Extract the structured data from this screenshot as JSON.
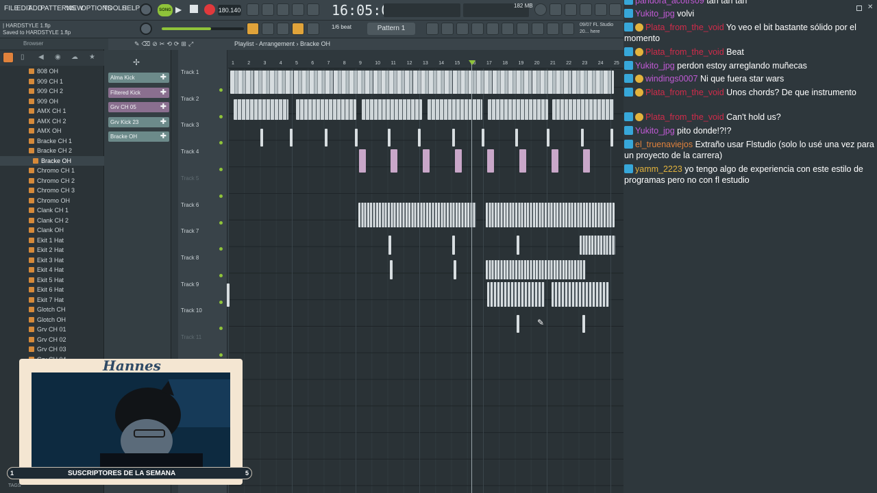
{
  "menu": [
    "FILE",
    "EDIT",
    "ADD",
    "PATTERNS",
    "VIEW",
    "OPTIONS",
    "TOOLS",
    "HELP"
  ],
  "transport": {
    "mode": "SONG",
    "tempo": "180.140",
    "time": "16:05:00",
    "cpu": "182 MB"
  },
  "hints": {
    "file": "| HARDSTYLE 1.flp",
    "saved": "Saved to HARDSTYLE 1.flp"
  },
  "toolbar": {
    "snap": "1/6 beat",
    "pattern": "Pattern 1",
    "news": "09/07 FL Studio 20... here"
  },
  "browser": {
    "title": "Browser",
    "items": [
      "808 OH",
      "909 CH 1",
      "909 CH 2",
      "909 OH",
      "AMX CH 1",
      "AMX CH 2",
      "AMX OH",
      "Bracke CH 1",
      "Bracke CH 2",
      "Bracke OH",
      "Chromo CH 1",
      "Chromo CH 2",
      "Chromo CH 3",
      "Chromo OH",
      "Clank CH 1",
      "Clank CH 2",
      "Clank OH",
      "Ekit 1 Hat",
      "Ekit 2 Hat",
      "Ekit 3 Hat",
      "Ekit 4 Hat",
      "Ekit 5 Hat",
      "Ekit 6 Hat",
      "Ekit 7 Hat",
      "Glotch CH",
      "Glotch OH",
      "Grv CH 01",
      "Grv CH 02",
      "Grv CH 03",
      "Grv CH 04"
    ],
    "selected": "Bracke OH",
    "bottom": "TAGS"
  },
  "channels": [
    {
      "name": "Alma Kick",
      "color": "#6c8a8a"
    },
    {
      "name": "Filtered Kick",
      "color": "#8a6f8f"
    },
    {
      "name": "Grv CH 05",
      "color": "#8a6f8f"
    },
    {
      "name": "Grv Kick 23",
      "color": "#6c8a8a"
    },
    {
      "name": "Bracke OH",
      "color": "#6c8a8a"
    }
  ],
  "playlist": {
    "title": "Playlist - Arrangement",
    "breadcrumb": "Bracke OH",
    "bars": [
      "1",
      "2",
      "3",
      "4",
      "5",
      "6",
      "7",
      "8",
      "9",
      "10",
      "11",
      "12",
      "13",
      "14",
      "15",
      "16",
      "17",
      "18",
      "19",
      "20",
      "21",
      "22",
      "23",
      "24",
      "25"
    ],
    "tracks": [
      "Track 1",
      "Track 2",
      "Track 3",
      "Track 4",
      "Track 5",
      "Track 6",
      "Track 7",
      "Track 8",
      "Track 9",
      "Track 10",
      "Track 11"
    ]
  },
  "chat": [
    {
      "user": "pandora_acotrs09",
      "color": "#c25ad6",
      "text": "tan tan tan"
    },
    {
      "user": "Yukito_jpg",
      "color": "#c25ad6",
      "text": "volvi"
    },
    {
      "user": "Plata_from_the_void",
      "color": "#d12b4a",
      "text": "Yo veo el bit bastante sólido por el momento"
    },
    {
      "user": "Plata_from_the_void",
      "color": "#d12b4a",
      "text": "Beat"
    },
    {
      "user": "Yukito_jpg",
      "color": "#c25ad6",
      "text": "perdon estoy arreglando muñecas"
    },
    {
      "user": "windings0007",
      "color": "#c25ad6",
      "text": "Ni que fuera star wars"
    },
    {
      "user": "Plata_from_the_void",
      "color": "#d12b4a",
      "text": "Unos chords? De que instrumento"
    },
    {
      "user": "Plata_from_the_void",
      "color": "#d12b4a",
      "text": "Can't hold us?"
    },
    {
      "user": "Yukito_jpg",
      "color": "#c25ad6",
      "text": "pito donde!?!?"
    },
    {
      "user": "el_truenaviejos",
      "color": "#e0823c",
      "text": "Extraño usar Flstudio (solo lo usé una vez para un proyecto de la carrera)"
    },
    {
      "user": "yamm_2223",
      "color": "#e3b33c",
      "text": "yo tengo algo de experiencia con este estilo de programas pero no con fl estudio"
    }
  ],
  "overlay": {
    "name": "Hannes",
    "subs_label": "SUSCRIPTORES DE LA SEMANA",
    "subs_left": "1",
    "subs_right": "5"
  }
}
